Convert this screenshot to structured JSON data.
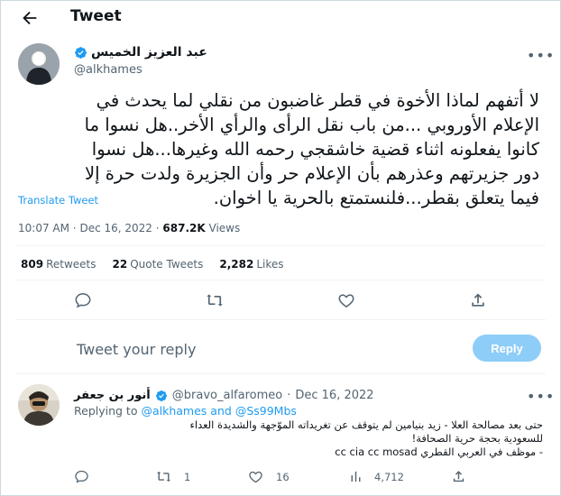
{
  "header": {
    "title": "Tweet"
  },
  "tweet": {
    "author_name": "عبد العزيز الخميس",
    "author_handle": "@alkhames",
    "lines": [
      "لا أتفهم لماذا الأخوة في قطر غاضبون من نقلي لما يحدث في",
      "الإعلام الأوروبي ...من باب نقل الرأى والرأي الأخر..هل نسوا ما",
      "كانوا يفعلونه اثناء قضية خاشقجي رحمه الله وغيرها...هل نسوا",
      "دور جزيرتهم وعذرهم بأن الإعلام حر وأن الجزيرة ولدت حرة إلا",
      "فيما يتعلق بقطر...فلنستمتع بالحرية يا اخوان."
    ],
    "translate_label": "Translate Tweet",
    "time": "10:07 AM",
    "date": "Dec 16, 2022",
    "views_count": "687.2K",
    "views_label": "Views",
    "separator": "·"
  },
  "stats": {
    "retweets_count": "809",
    "retweets_label": "Retweets",
    "quotes_count": "22",
    "quotes_label": "Quote Tweets",
    "likes_count": "2,282",
    "likes_label": "Likes"
  },
  "compose": {
    "placeholder": "Tweet your reply",
    "reply_button": "Reply"
  },
  "reply": {
    "author_name": "أنور بن جعفر",
    "author_handle": "@bravo_alfaromeo",
    "separator": "·",
    "date": "Dec 16, 2022",
    "replying_prefix": "Replying to",
    "replying_user1": "@alkhames",
    "replying_and": "and",
    "replying_user2": "@Ss99Mbs",
    "lines": [
      "حتى بعد مصالحة العلا - زيد بنيامين لم يتوقف عن تغريداته الموّجهة والشديدة العداء",
      "للسعودية بحجة حرية الصحافة!",
      "- موظف في العربي القطري cc cia cc mosad"
    ],
    "retweets": "1",
    "likes": "16",
    "views": "4,712"
  },
  "icons": {
    "back": "arrow-left-icon",
    "verified": "verified-badge-icon",
    "more": "more-icon",
    "reply": "reply-icon",
    "retweet": "retweet-icon",
    "like": "heart-icon",
    "share": "share-icon",
    "views": "analytics-icon"
  },
  "colors": {
    "accent": "#1d9bf0",
    "muted": "#536471",
    "text": "#0f1419",
    "reply_button_disabled": "#8ecdf8"
  }
}
